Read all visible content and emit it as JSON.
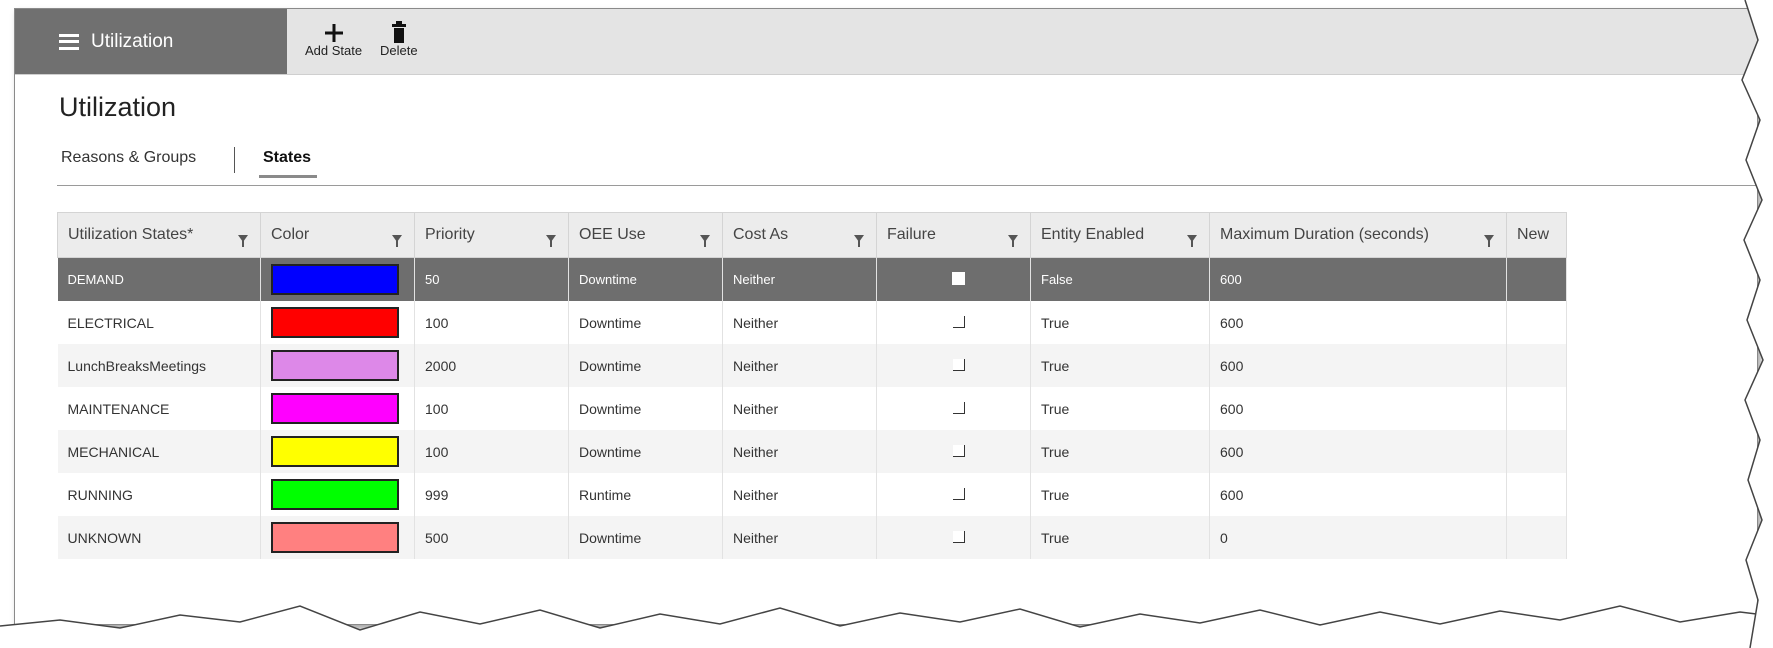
{
  "app": {
    "menu_label": "Utilization",
    "page_title": "Utilization"
  },
  "toolbar": {
    "add_label": "Add State",
    "delete_label": "Delete"
  },
  "tabs": [
    {
      "label": "Reasons & Groups",
      "active": false
    },
    {
      "label": "States",
      "active": true
    }
  ],
  "grid": {
    "columns": [
      "Utilization States*",
      "Color",
      "Priority",
      "OEE Use",
      "Cost As",
      "Failure",
      "Entity Enabled",
      "Maximum Duration (seconds)",
      "New"
    ],
    "rows": [
      {
        "state": "DEMAND",
        "color": "#0000ff",
        "priority": "50",
        "oee_use": "Downtime",
        "cost_as": "Neither",
        "failure": false,
        "entity_enabled": "False",
        "max_duration": "600",
        "selected": true
      },
      {
        "state": "ELECTRICAL",
        "color": "#ff0000",
        "priority": "100",
        "oee_use": "Downtime",
        "cost_as": "Neither",
        "failure": false,
        "entity_enabled": "True",
        "max_duration": "600",
        "selected": false
      },
      {
        "state": "LunchBreaksMeetings",
        "color": "#dd88e8",
        "priority": "2000",
        "oee_use": "Downtime",
        "cost_as": "Neither",
        "failure": false,
        "entity_enabled": "True",
        "max_duration": "600",
        "selected": false
      },
      {
        "state": "MAINTENANCE",
        "color": "#ff00ff",
        "priority": "100",
        "oee_use": "Downtime",
        "cost_as": "Neither",
        "failure": false,
        "entity_enabled": "True",
        "max_duration": "600",
        "selected": false
      },
      {
        "state": "MECHANICAL",
        "color": "#ffff00",
        "priority": "100",
        "oee_use": "Downtime",
        "cost_as": "Neither",
        "failure": false,
        "entity_enabled": "True",
        "max_duration": "600",
        "selected": false
      },
      {
        "state": "RUNNING",
        "color": "#00ff00",
        "priority": "999",
        "oee_use": "Runtime",
        "cost_as": "Neither",
        "failure": false,
        "entity_enabled": "True",
        "max_duration": "600",
        "selected": false
      },
      {
        "state": "UNKNOWN",
        "color": "#ff8080",
        "priority": "500",
        "oee_use": "Downtime",
        "cost_as": "Neither",
        "failure": false,
        "entity_enabled": "True",
        "max_duration": "0",
        "selected": false
      }
    ]
  }
}
